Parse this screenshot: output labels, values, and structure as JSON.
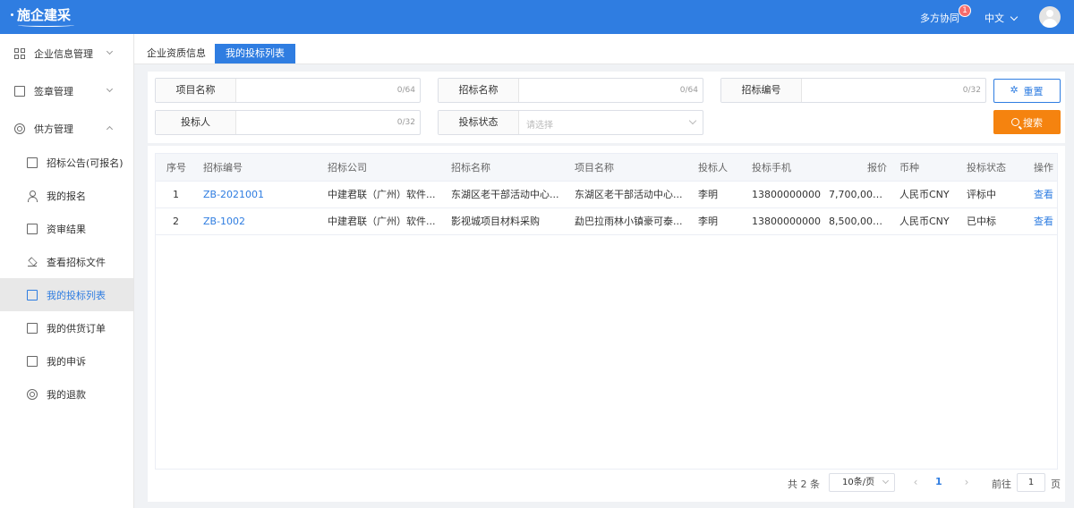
{
  "header": {
    "logo": "施企建采",
    "collab": "多方协同",
    "badge": "1",
    "lang": "中文"
  },
  "sidebar": {
    "items": [
      {
        "label": "企业信息管理"
      },
      {
        "label": "签章管理"
      },
      {
        "label": "供方管理"
      },
      {
        "label": "招标公告(可报名)"
      },
      {
        "label": "我的报名"
      },
      {
        "label": "资审结果"
      },
      {
        "label": "查看招标文件"
      },
      {
        "label": "我的投标列表"
      },
      {
        "label": "我的供货订单"
      },
      {
        "label": "我的申诉"
      },
      {
        "label": "我的退款"
      }
    ]
  },
  "tabs": [
    {
      "label": "企业资质信息"
    },
    {
      "label": "我的投标列表"
    }
  ],
  "filters": {
    "project_name": {
      "label": "项目名称",
      "count": "0/64"
    },
    "tender_name": {
      "label": "招标名称",
      "count": "0/64"
    },
    "tender_no": {
      "label": "招标编号",
      "count": "0/32"
    },
    "bidder": {
      "label": "投标人",
      "count": "0/32"
    },
    "status": {
      "label": "投标状态",
      "placeholder": "请选择"
    },
    "reset": "重置",
    "search": "搜索"
  },
  "table": {
    "columns": [
      "序号",
      "招标编号",
      "招标公司",
      "招标名称",
      "项目名称",
      "投标人",
      "投标手机",
      "报价",
      "币种",
      "投标状态",
      "操作"
    ],
    "rows": [
      [
        "1",
        "ZB-2021001",
        "中建君联（广州）软件...",
        "东湖区老干部活动中心...",
        "东湖区老干部活动中心...",
        "李明",
        "13800000000",
        "7,700,000....",
        "人民币CNY",
        "评标中",
        "查看"
      ],
      [
        "2",
        "ZB-1002",
        "中建君联（广州）软件...",
        "影视城项目材料采购",
        "勐巴拉雨林小镇豪可泰...",
        "李明",
        "13800000000",
        "8,500,000....",
        "人民币CNY",
        "已中标",
        "查看"
      ]
    ]
  },
  "pager": {
    "total": "共 2 条",
    "size": "10条/页",
    "prev": "‹",
    "current": "1",
    "next": "›",
    "goto": "前往",
    "goto_value": "1",
    "page": "页"
  },
  "colors": {
    "primary": "#2f7de1",
    "search": "#f5830f",
    "badge": "#f56c6c"
  }
}
